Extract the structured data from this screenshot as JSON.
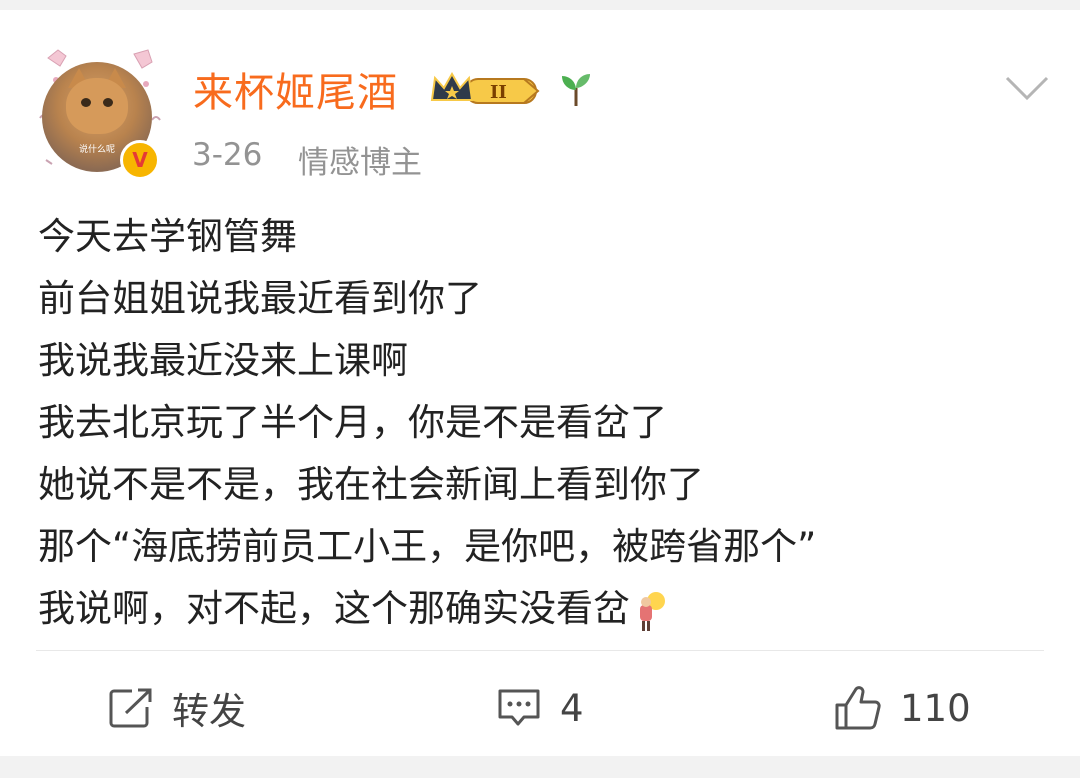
{
  "post": {
    "author": {
      "name": "来杯姬尾酒",
      "avatar_caption": "说什么呢",
      "verified_mark": "V",
      "vip_level": "II",
      "date": "3-26",
      "role": "情感博主"
    },
    "lines": [
      "今天去学钢管舞",
      "前台姐姐说我最近看到你了",
      "我说我最近没来上课啊",
      "我去北京玩了半个月，你是不是看岔了",
      "她说不是不是，我在社会新闻上看到你了",
      "那个“海底捞前员工小王，是你吧，被跨省那个”",
      "我说啊，对不起，这个那确实没看岔"
    ]
  },
  "actions": {
    "repost_label": "转发",
    "comment_count": "4",
    "like_count": "110"
  },
  "colors": {
    "username": "#f86b1d",
    "meta": "#939393",
    "text": "#222222",
    "background": "#f2f2f2"
  },
  "icons": [
    "verified-icon",
    "crown-badge-icon",
    "sprout-icon",
    "chevron-down-icon",
    "lightbulb-emoji-icon",
    "repost-icon",
    "comment-icon",
    "like-icon"
  ]
}
